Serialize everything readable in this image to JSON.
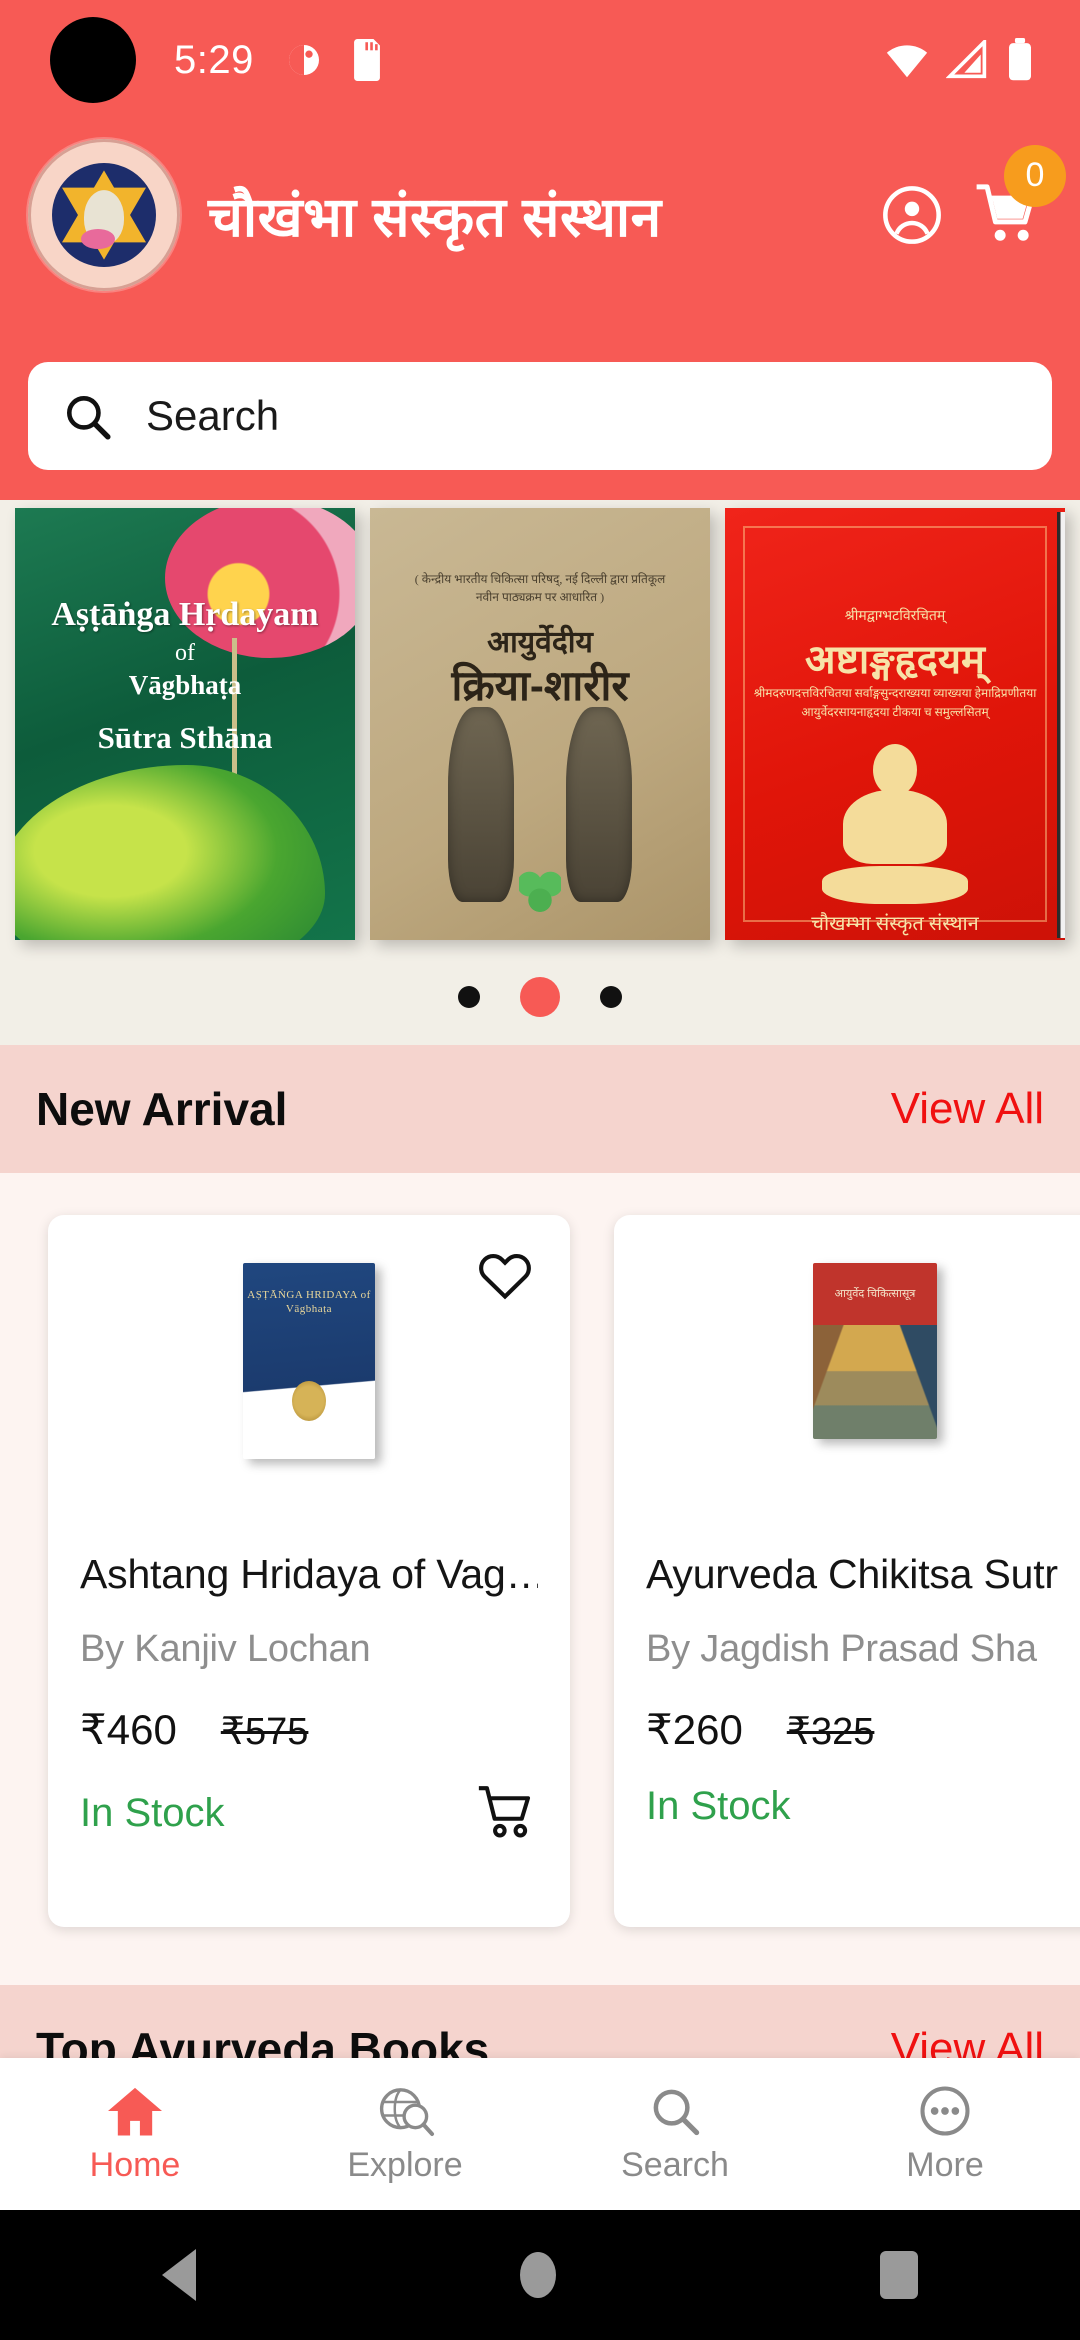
{
  "status_bar": {
    "time": "5:29",
    "icons": [
      "camera-punch-hole",
      "alarm-icon",
      "sd-card-icon",
      "wifi-icon",
      "signal-icon",
      "battery-icon"
    ]
  },
  "app_bar": {
    "title": "चौखंभा संस्कृत संस्थान",
    "logo_alt": "चौखम्बा संस्कृत संस्थान, वाराणसी",
    "account_icon": "account-circle-icon",
    "cart_icon": "cart-icon",
    "cart_count": "0",
    "brand_color": "#f75a55",
    "badge_color": "#f79c1d"
  },
  "search": {
    "placeholder": "Search",
    "icon": "search-icon"
  },
  "banner": {
    "books": [
      {
        "line1": "Aṣṭāṅga Hṛdayam",
        "line2": "of",
        "line3": "Vāgbhaṭa",
        "line4": "Sūtra Sthāna"
      },
      {
        "subtitle": "( केन्द्रीय भारतीय चिकित्सा परिषद्, नई दिल्ली द्वारा प्रतिकूल नवीन पाठ्यक्रम पर आधारित )",
        "line1": "आयुर्वेदीय",
        "line2": "क्रिया-शारीर"
      },
      {
        "line0": "श्रीमद्वाग्भटविरचितम्",
        "line1": "अष्टाङ्गहृदयम्",
        "line2": "श्रीमदरुणदत्तविरचितया सर्वाङ्गसुन्दराख्यया व्याख्यया हेमाद्रिप्रणीतया आयुर्वेदरसायनाहृदया टीकया च समुल्लसितम्",
        "line3": "चौखम्भा संस्कृत संस्थान"
      }
    ],
    "dots": {
      "count": 3,
      "active_index": 1,
      "active_color": "#f75a55",
      "inactive_color": "#111111"
    }
  },
  "sections": [
    {
      "title": "New Arrival",
      "view_all": "View All"
    },
    {
      "title": "Top Avurveda Books",
      "view_all": "View All"
    }
  ],
  "products": [
    {
      "title": "Ashtang Hridaya of Vag…",
      "author": "By Kanjiv Lochan",
      "price": "₹460",
      "old_price": "₹575",
      "stock": "In Stock",
      "favorite_icon": "heart-outline-icon",
      "cart_icon": "add-to-cart-icon",
      "cover_title": "AṢṬĀṄGA HRIDAYA of Vāgbhaṭa"
    },
    {
      "title": "Ayurveda Chikitsa Sutr",
      "author": "By Jagdish Prasad Sha",
      "price": "₹260",
      "old_price": "₹325",
      "stock": "In Stock",
      "favorite_icon": "heart-outline-icon",
      "cart_icon": "add-to-cart-icon",
      "cover_title": "आयुर्वेद चिकित्सासूत्र"
    }
  ],
  "bottom_nav": {
    "items": [
      {
        "label": "Home",
        "icon": "home-icon",
        "active": true
      },
      {
        "label": "Explore",
        "icon": "explore-globe-icon",
        "active": false
      },
      {
        "label": "Search",
        "icon": "search-icon",
        "active": false
      },
      {
        "label": "More",
        "icon": "more-dots-icon",
        "active": false
      }
    ],
    "active_color": "#f75a55",
    "inactive_color": "#8a8a8a"
  },
  "android_nav": {
    "back": "back-icon",
    "home": "home-circle-icon",
    "recents": "recents-icon"
  }
}
